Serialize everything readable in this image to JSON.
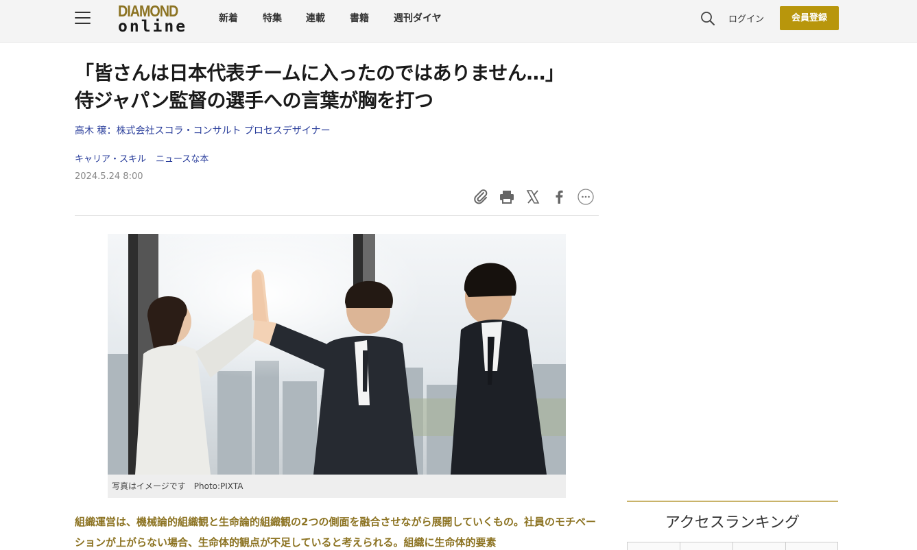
{
  "header": {
    "logo_line1": "DIAMOND",
    "logo_line2": "online",
    "nav": [
      "新着",
      "特集",
      "連載",
      "書籍",
      "週刊ダイヤ"
    ],
    "login_label": "ログイン",
    "register_label": "会員登録"
  },
  "article": {
    "title": "「皆さんは日本代表チームに入ったのではありません…」侍ジャパン監督の選手への言葉が胸を打つ",
    "author": "高木 穣：株式会社スコラ・コンサルト プロセスデザイナー",
    "tags": [
      "キャリア・スキル",
      "ニュースな本"
    ],
    "date": "2024.5.24 8:00",
    "share_icons": [
      "clip-icon",
      "print-icon",
      "x-icon",
      "facebook-icon",
      "more-icon"
    ],
    "photo_caption": "写真はイメージです　Photo:PIXTA",
    "lead": "組織運営は、機械論的組織観と生命論的組織観の2つの側面を融合させながら展開していくもの。社員のモチベーションが上がらない場合、生命体的観点が不足していると考えられる。組織に生命体的要素"
  },
  "sidebar": {
    "ranking_title": "アクセスランキング"
  },
  "colors": {
    "brand_gold": "#b8960c",
    "lead_gold": "#8c7322",
    "link_blue": "#2b3f9c"
  }
}
